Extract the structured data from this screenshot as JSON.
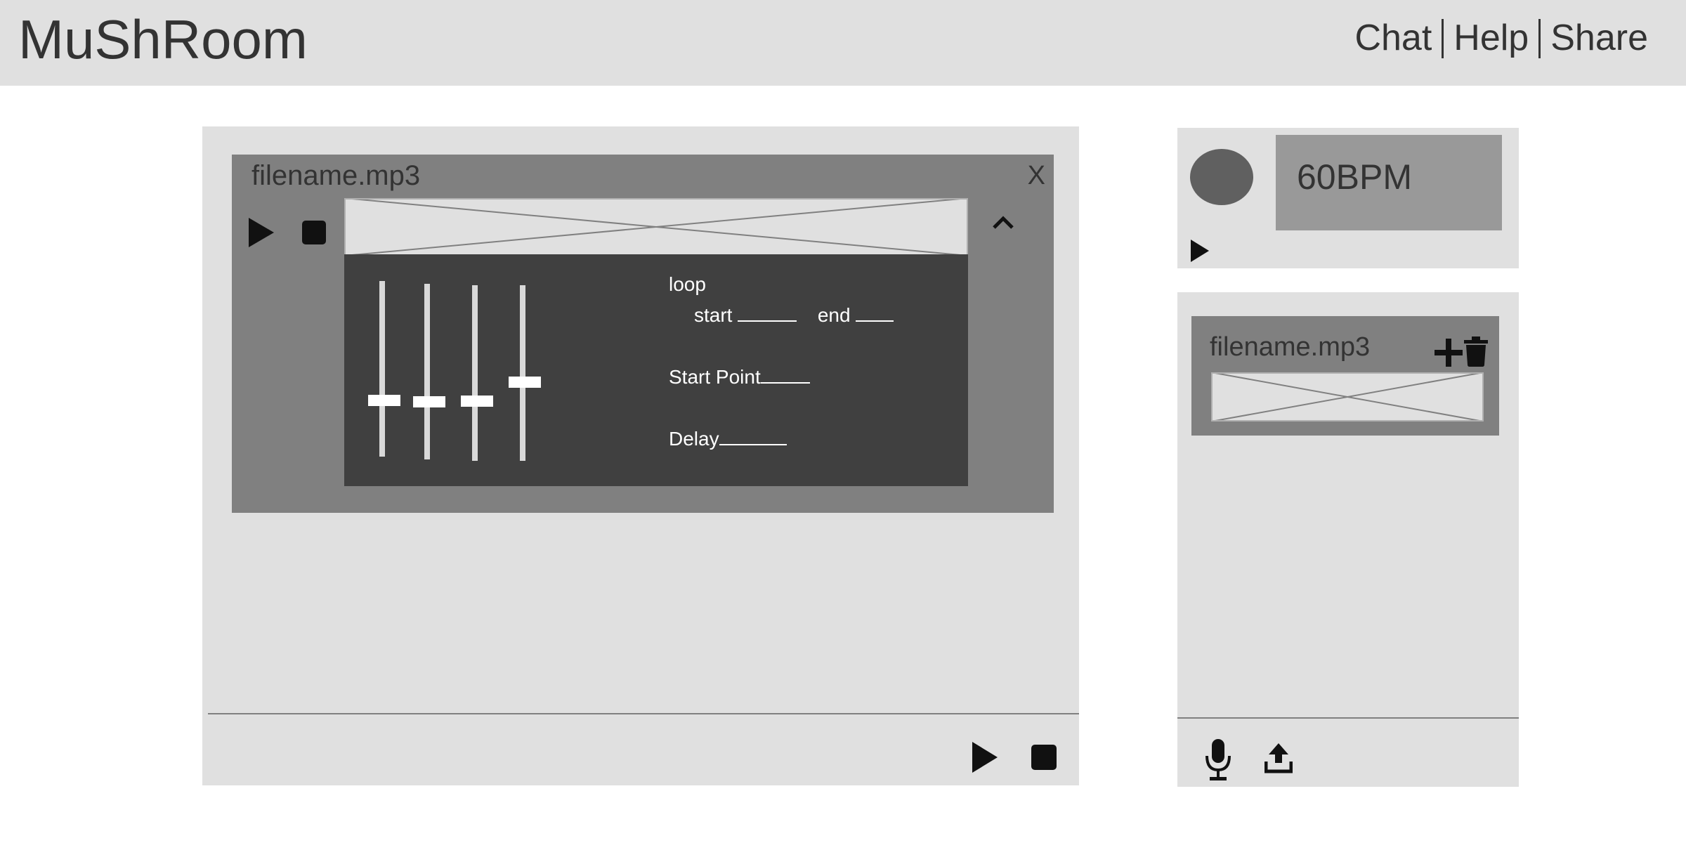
{
  "app": {
    "title": "MuShRoom"
  },
  "nav": {
    "items": [
      "Chat",
      "Help",
      "Share"
    ]
  },
  "track": {
    "filename": "filename.mp3",
    "close_label": "X",
    "controls": {
      "loop_label": "loop",
      "start_label": "start",
      "end_label": "end",
      "start_point_label": "Start Point",
      "delay_label": "Delay"
    },
    "sliders": [
      0.68,
      0.67,
      0.66,
      0.55
    ]
  },
  "tempo": {
    "bpm": "60BPM"
  },
  "library": {
    "items": [
      {
        "filename": "filename.mp3"
      }
    ]
  },
  "icons": {
    "play": "play-icon",
    "stop": "stop-icon",
    "collapse": "chevron-up-icon",
    "add": "plus-icon",
    "delete": "trash-icon",
    "microphone": "microphone-icon",
    "upload": "upload-icon"
  },
  "colors": {
    "header_bg": "#e0e0e0",
    "panel_bg": "#e0e0e0",
    "card_bg": "#808080",
    "effects_bg": "#404040",
    "bpm_box": "#999999",
    "tempo_circle": "#606060",
    "text": "#333333"
  }
}
